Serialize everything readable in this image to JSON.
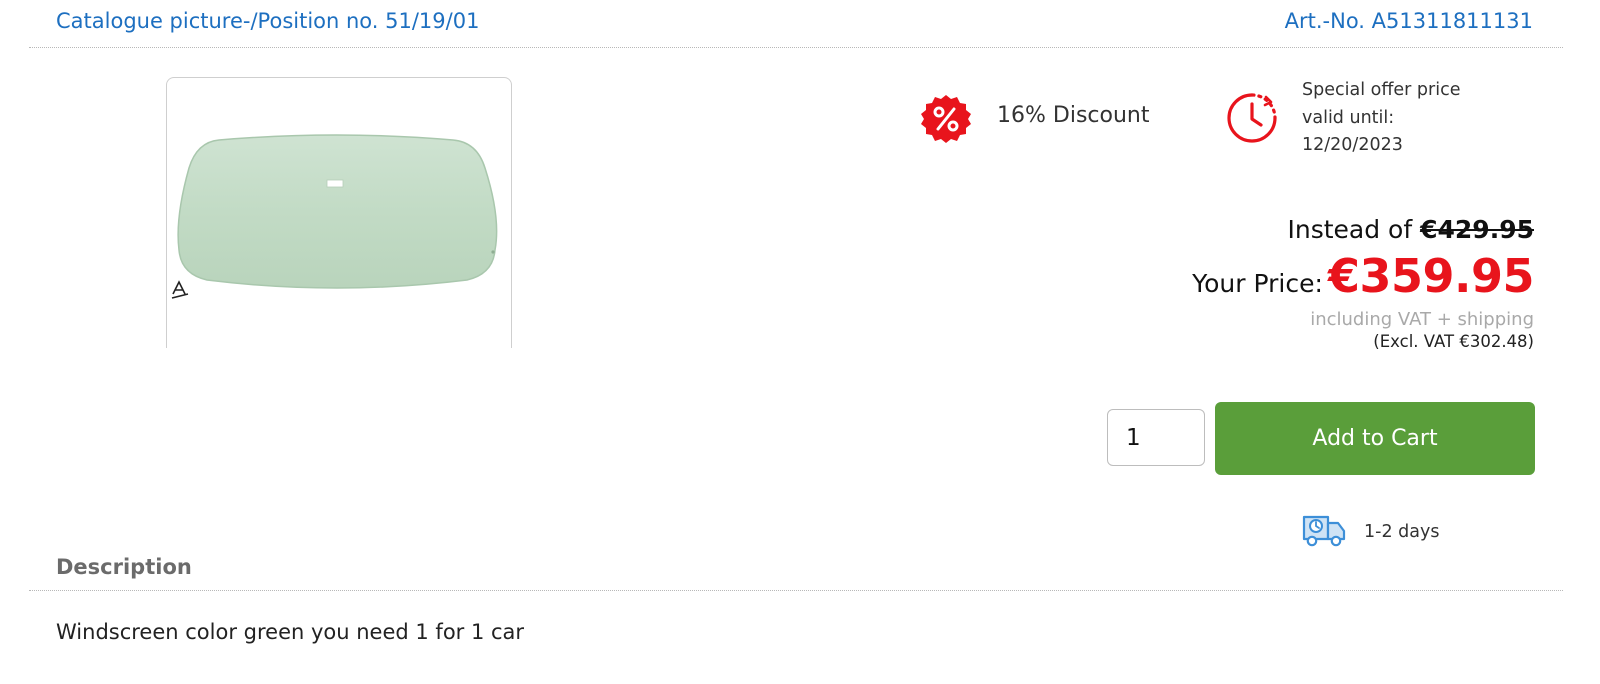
{
  "header": {
    "catalogue_link": "Catalogue picture-/Position no. 51/19/01",
    "art_no": "Art.-No. A51311811131"
  },
  "product": {
    "image_alt": "Windscreen green"
  },
  "promo": {
    "discount_label": "16% Discount",
    "offer_line1": "Special offer price",
    "offer_line2": "valid until:",
    "offer_date": "12/20/2023"
  },
  "pricing": {
    "instead_of_label": "Instead of",
    "old_price": "€429.95",
    "your_price_label": "Your Price:",
    "price": "€359.95",
    "vat_note": "including VAT + shipping",
    "excl_vat": "(Excl. VAT €302.48)"
  },
  "cart": {
    "quantity": "1",
    "add_to_cart_label": "Add to Cart"
  },
  "delivery": {
    "time": "1-2 days"
  },
  "description": {
    "heading": "Description",
    "text": "Windscreen color green you need 1 for 1 car"
  },
  "colors": {
    "link_blue": "#1d6fc0",
    "price_red": "#e8141c",
    "cart_green": "#5a9e3a",
    "icon_red": "#e8141c",
    "truck_blue": "#3d8fd8"
  },
  "icons": {
    "discount": "percent-badge-icon",
    "timer": "clock-timer-icon",
    "delivery": "delivery-truck-icon"
  }
}
